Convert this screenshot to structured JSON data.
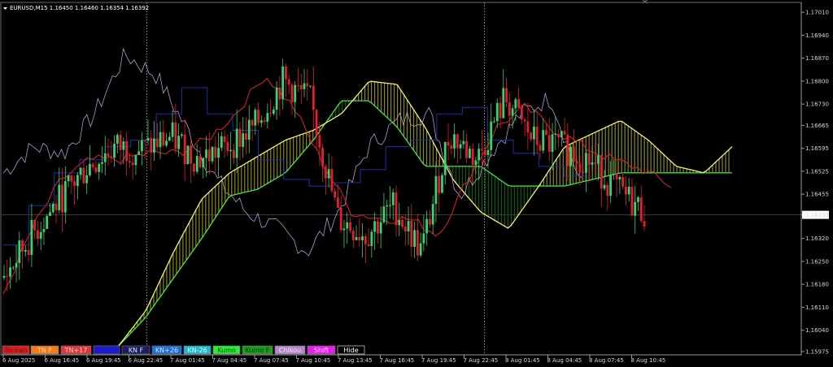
{
  "window": {
    "title": "EURUSD,M15  1.16450 1.16460 1.16354 1.16392"
  },
  "colors": {
    "background": "#000000",
    "bull": "#3bd16f",
    "bear": "#e0202f",
    "tenkan": "#e02424",
    "kijun": "#1f2fa8",
    "chikou": "#b39bc8",
    "span_a": "#f0f07a",
    "span_b": "#49e24b",
    "kumo_bull_fill": "#8a8a1a",
    "kumo_bear_fill": "#0d5a12",
    "grid": "#ffffff",
    "text": "#d8d8d8",
    "price_tag_bg": "#ffffff"
  },
  "indicator_buttons": [
    {
      "label": "Tenkan",
      "bg": "#d42020",
      "fg": "#7a1010"
    },
    {
      "label": "TN F",
      "bg": "#f07c1e",
      "fg": "#ffd7a0"
    },
    {
      "label": "TN+17",
      "bg": "#d83a3a",
      "fg": "#ffc7c7"
    },
    {
      "label": "",
      "bg": "#1c1cc8",
      "fg": "#ffffff"
    },
    {
      "label": "KN F",
      "bg": "#1a1f5a",
      "fg": "#e0e0ff"
    },
    {
      "label": "KN+26",
      "bg": "#1e6fd8",
      "fg": "#cfe3ff"
    },
    {
      "label": "KN-26",
      "bg": "#20b8d0",
      "fg": "#e0ffff"
    },
    {
      "label": "Kumo",
      "bg": "#2ee83a",
      "fg": "#0a5010"
    },
    {
      "label": "Kumo F",
      "bg": "#1e9a1e",
      "fg": "#0c3c0c"
    },
    {
      "label": "Chikou",
      "bg": "#b388c8",
      "fg": "#f3e3ff"
    },
    {
      "label": "Shift",
      "bg": "#e61ee6",
      "fg": "#ffd0ff"
    },
    {
      "label": "Hide",
      "bg": "#000000",
      "fg": "#ffffff"
    }
  ],
  "chart_data": {
    "type": "candlestick",
    "symbol": "EURUSD",
    "timeframe": "M15",
    "ohlc_current": {
      "open": 1.1645,
      "high": 1.1646,
      "low": 1.16354,
      "close": 1.16392
    },
    "current_price": 1.16392,
    "y_ticks": [
      "1.17010",
      "1.16940",
      "1.16870",
      "1.16800",
      "1.16730",
      "1.16665",
      "1.16595",
      "1.16525",
      "1.16455",
      "1.16392",
      "1.16320",
      "1.16250",
      "1.16180",
      "1.16110",
      "1.16040",
      "1.15975"
    ],
    "ylim": [
      1.15965,
      1.1704
    ],
    "x_ticks": [
      "6 Aug 2025",
      "6 Aug 16:45",
      "6 Aug 19:45",
      "6 Aug 22:45",
      "7 Aug 01:45",
      "7 Aug 04:45",
      "7 Aug 07:45",
      "7 Aug 10:45",
      "7 Aug 13:45",
      "7 Aug 16:45",
      "7 Aug 19:45",
      "7 Aug 22:45",
      "8 Aug 01:45",
      "8 Aug 04:45",
      "8 Aug 07:45",
      "8 Aug 10:45"
    ],
    "vertical_markers": [
      "6 Aug 22:45",
      "7 Aug 22:45"
    ],
    "close_anchors": [
      1.162,
      1.1633,
      1.1644,
      1.1654,
      1.166,
      1.1659,
      1.1663,
      1.1656,
      1.166,
      1.1666,
      1.168,
      1.1674,
      1.1638,
      1.1633,
      1.1642,
      1.1628,
      1.1664,
      1.1656,
      1.1675,
      1.1662,
      1.166,
      1.1656,
      1.1647,
      1.164
    ],
    "tenkan_anchors": [
      1.1615,
      1.1635,
      1.165,
      1.1656,
      1.1656,
      1.1658,
      1.1658,
      1.1662,
      1.167,
      1.1682,
      1.1672,
      1.1655,
      1.164,
      1.1638,
      1.1638,
      1.1633,
      1.165,
      1.1666,
      1.1672,
      1.1665,
      1.166,
      1.1656,
      1.1653,
      1.1648
    ],
    "kijun_anchors": [
      1.163,
      1.1642,
      1.1652,
      1.1656,
      1.166,
      1.1662,
      1.167,
      1.1678,
      1.167,
      1.1665,
      1.1656,
      1.165,
      1.1648,
      1.1649,
      1.1653,
      1.166,
      1.1662,
      1.167,
      1.1672,
      1.1662,
      1.1658,
      1.1654,
      1.1651,
      1.165
    ],
    "chikou_anchors": [
      1.1652,
      1.166,
      1.1658,
      1.167,
      1.1688,
      1.1682,
      1.1666,
      1.165,
      1.164,
      1.1635,
      1.1628,
      1.164,
      1.166,
      1.1668,
      1.167,
      1.1645,
      1.1658,
      1.167,
      1.1675,
      1.1648
    ],
    "span_a_anchors": [
      1.1599,
      1.161,
      1.1628,
      1.1644,
      1.1652,
      1.1657,
      1.1662,
      1.1665,
      1.167,
      1.168,
      1.1679,
      1.1666,
      1.165,
      1.164,
      1.1635,
      1.1647,
      1.166,
      1.1664,
      1.1668,
      1.1662,
      1.1654,
      1.1652,
      1.166
    ],
    "span_b_anchors": [
      1.1599,
      1.1608,
      1.162,
      1.1632,
      1.1645,
      1.1647,
      1.1652,
      1.1662,
      1.1674,
      1.1674,
      1.1666,
      1.1654,
      1.1654,
      1.1654,
      1.1648,
      1.1648,
      1.1648,
      1.165,
      1.1652,
      1.1652,
      1.1652,
      1.1652,
      1.1652
    ]
  }
}
